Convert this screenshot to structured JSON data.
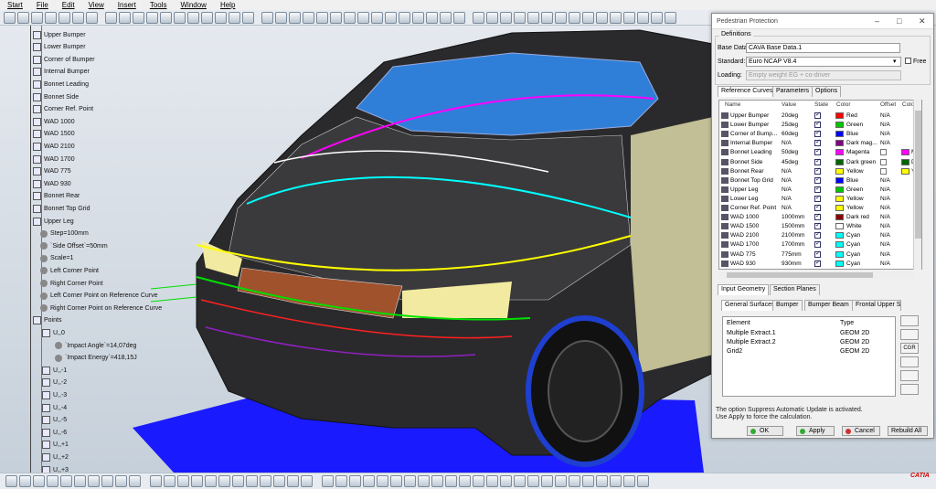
{
  "menu": [
    "Start",
    "File",
    "Edit",
    "View",
    "Insert",
    "Tools",
    "Window",
    "Help"
  ],
  "tree": {
    "items": [
      {
        "label": "Upper Bumper",
        "kind": "node"
      },
      {
        "label": "Lower Bumper",
        "kind": "node"
      },
      {
        "label": "Corner of Bumper",
        "kind": "node"
      },
      {
        "label": "Internal Bumper",
        "kind": "node"
      },
      {
        "label": "Bonnet Leading",
        "kind": "node"
      },
      {
        "label": "Bonnet Side",
        "kind": "node"
      },
      {
        "label": "Corner Ref. Point",
        "kind": "node"
      },
      {
        "label": "WAD 1000",
        "kind": "node"
      },
      {
        "label": "WAD 1500",
        "kind": "node"
      },
      {
        "label": "WAD 2100",
        "kind": "node"
      },
      {
        "label": "WAD 1700",
        "kind": "node"
      },
      {
        "label": "WAD 775",
        "kind": "node"
      },
      {
        "label": "WAD 930",
        "kind": "node"
      },
      {
        "label": "Bonnet Rear",
        "kind": "node"
      },
      {
        "label": "Bonnet Top Grid",
        "kind": "node"
      },
      {
        "label": "Upper Leg",
        "kind": "node"
      },
      {
        "label": "Step=100mm",
        "kind": "param"
      },
      {
        "label": "`Side Offset`=50mm",
        "kind": "param"
      },
      {
        "label": "Scale=1",
        "kind": "param"
      },
      {
        "label": "Left Corner Point",
        "kind": "param"
      },
      {
        "label": "Right Corner Point",
        "kind": "param"
      },
      {
        "label": "Left Corner Point on Reference Curve",
        "kind": "param"
      },
      {
        "label": "Right Corner Point on Reference Curve",
        "kind": "param"
      },
      {
        "label": "Points",
        "kind": "folder"
      },
      {
        "label": "U,,0",
        "kind": "point"
      },
      {
        "label": "`Impact Angle`=14,07deg",
        "kind": "param"
      },
      {
        "label": "`Impact Energy`=418,15J",
        "kind": "param"
      },
      {
        "label": "U,,-1",
        "kind": "point"
      },
      {
        "label": "U,,-2",
        "kind": "point"
      },
      {
        "label": "U,,-3",
        "kind": "point"
      },
      {
        "label": "U,,-4",
        "kind": "point"
      },
      {
        "label": "U,,-5",
        "kind": "point"
      },
      {
        "label": "U,,-6",
        "kind": "point"
      },
      {
        "label": "U,,+1",
        "kind": "point"
      },
      {
        "label": "U,,+2",
        "kind": "point"
      },
      {
        "label": "U,,+3",
        "kind": "point"
      }
    ]
  },
  "dialog": {
    "title": "Pedestrian Protection",
    "definitions_label": "Definitions",
    "base_data_label": "Base Data:",
    "base_data_value": "CAVA Base Data.1",
    "standard_label": "Standard:",
    "standard_value": "Euro NCAP V8.4",
    "free_label": "Free",
    "loading_label": "Loading:",
    "loading_value": "Empty weight EG + co-driver",
    "tabs_top": [
      "Reference Curves",
      "Parameters",
      "Options"
    ],
    "curve_columns": [
      "Name",
      "Value",
      "State",
      "Color",
      "Offset",
      "Colo"
    ],
    "curves": [
      {
        "name": "Upper Bumper",
        "value": "20deg",
        "color_name": "Red",
        "color": "#ff0000",
        "offset": "N/A",
        "extra": ""
      },
      {
        "name": "Lower Bumper",
        "value": "25deg",
        "color_name": "Green",
        "color": "#00c800",
        "offset": "N/A",
        "extra": ""
      },
      {
        "name": "Corner of Bump...",
        "value": "60deg",
        "color_name": "Blue",
        "color": "#0000ff",
        "offset": "N/A",
        "extra": ""
      },
      {
        "name": "Internal Bumper",
        "value": "N/A",
        "color_name": "Dark mag...",
        "color": "#800080",
        "offset": "N/A",
        "extra": ""
      },
      {
        "name": "Bonnet Leading",
        "value": "50deg",
        "color_name": "Magenta",
        "color": "#ff00ff",
        "offset": "",
        "extra": "Ma",
        "extra_color": "#ff00ff"
      },
      {
        "name": "Bonnet Side",
        "value": "45deg",
        "color_name": "Dark green",
        "color": "#006400",
        "offset": "",
        "extra": "Da",
        "extra_color": "#006400"
      },
      {
        "name": "Bonnet Rear",
        "value": "N/A",
        "color_name": "Yellow",
        "color": "#ffff00",
        "offset": "",
        "extra": "Yel",
        "extra_color": "#ffff00"
      },
      {
        "name": "Bonnet Top Grid",
        "value": "N/A",
        "color_name": "Blue",
        "color": "#0000ff",
        "offset": "N/A",
        "extra": ""
      },
      {
        "name": "Upper Leg",
        "value": "N/A",
        "color_name": "Green",
        "color": "#00c800",
        "offset": "N/A",
        "extra": ""
      },
      {
        "name": "Lower Leg",
        "value": "N/A",
        "color_name": "Yellow",
        "color": "#ffff00",
        "offset": "N/A",
        "extra": ""
      },
      {
        "name": "Corner Ref. Point",
        "value": "N/A",
        "color_name": "Yellow",
        "color": "#ffff00",
        "offset": "N/A",
        "extra": ""
      },
      {
        "name": "WAD 1000",
        "value": "1000mm",
        "color_name": "Dark red",
        "color": "#8b0000",
        "offset": "N/A",
        "extra": ""
      },
      {
        "name": "WAD 1500",
        "value": "1500mm",
        "color_name": "White",
        "color": "#ffffff",
        "offset": "N/A",
        "extra": ""
      },
      {
        "name": "WAD 2100",
        "value": "2100mm",
        "color_name": "Cyan",
        "color": "#00ffff",
        "offset": "N/A",
        "extra": ""
      },
      {
        "name": "WAD 1700",
        "value": "1700mm",
        "color_name": "Cyan",
        "color": "#00ffff",
        "offset": "N/A",
        "extra": ""
      },
      {
        "name": "WAD 775",
        "value": "775mm",
        "color_name": "Cyan",
        "color": "#00ffff",
        "offset": "N/A",
        "extra": ""
      },
      {
        "name": "WAD 930",
        "value": "930mm",
        "color_name": "Cyan",
        "color": "#00ffff",
        "offset": "N/A",
        "extra": ""
      }
    ],
    "tabs_mid": [
      "Input Geometry",
      "Section Planes"
    ],
    "tabs_sub": [
      "General Surfaces",
      "Bumper",
      "Bumper Beam",
      "Frontal Upper Surf"
    ],
    "element_columns": [
      "Element",
      "Type"
    ],
    "elements": [
      {
        "name": "Multiple Extract.1",
        "type": "GEOM 2D"
      },
      {
        "name": "Multiple Extract.2",
        "type": "GEOM 2D"
      },
      {
        "name": "Grid2",
        "type": "GEOM 2D"
      }
    ],
    "side_buttons": [
      "",
      "",
      "CGR",
      "",
      "",
      ""
    ],
    "note_line1": "The option Suppress Automatic Update is activated.",
    "note_line2": "Use Apply to force the calculation.",
    "ok_label": "OK",
    "apply_label": "Apply",
    "cancel_label": "Cancel",
    "rebuild_label": "Rebuild All"
  },
  "status": {
    "logo": "CATIA"
  },
  "colors": {
    "floor": "#1a1aff",
    "car_body": "#2a2a2c",
    "glass": "#2f7fd8"
  }
}
